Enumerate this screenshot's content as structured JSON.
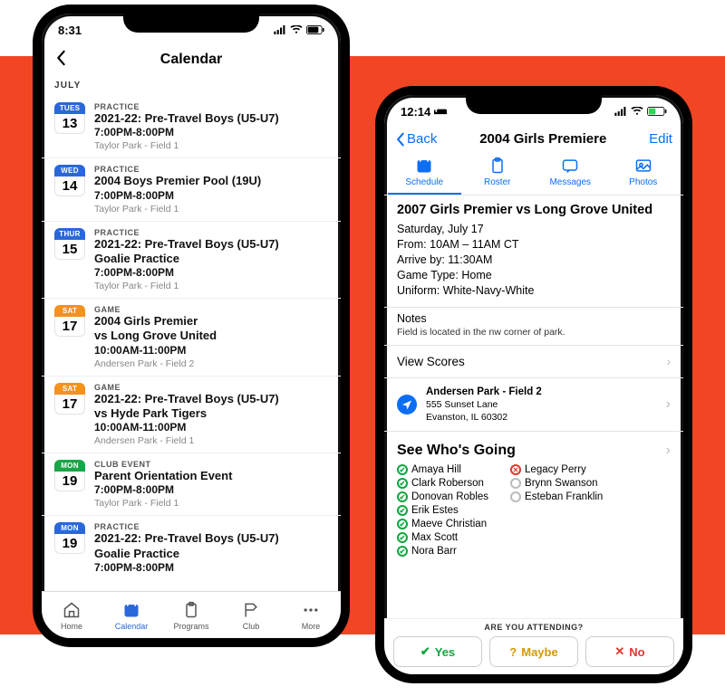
{
  "left": {
    "status_time": "8:31",
    "header_title": "Calendar",
    "month_label": "JULY",
    "events": [
      {
        "dow": "TUES",
        "day": "13",
        "dowColor": "blue",
        "type": "PRACTICE",
        "title": "2021-22: Pre-Travel Boys (U5-U7)",
        "sub": "",
        "time": "7:00PM-8:00PM",
        "loc": "Taylor Park - Field 1"
      },
      {
        "dow": "WED",
        "day": "14",
        "dowColor": "blue",
        "type": "PRACTICE",
        "title": "2004 Boys Premier Pool (19U)",
        "sub": "",
        "time": "7:00PM-8:00PM",
        "loc": "Taylor Park - Field 1"
      },
      {
        "dow": "THUR",
        "day": "15",
        "dowColor": "blue",
        "type": "PRACTICE",
        "title": "2021-22: Pre-Travel Boys (U5-U7)",
        "sub": "Goalie Practice",
        "time": "7:00PM-8:00PM",
        "loc": "Taylor Park - Field 1"
      },
      {
        "dow": "SAT",
        "day": "17",
        "dowColor": "orange",
        "type": "GAME",
        "title": "2004 Girls Premier",
        "sub": "vs Long Grove United",
        "time": "10:00AM-11:00PM",
        "loc": "Andersen Park - Field 2"
      },
      {
        "dow": "SAT",
        "day": "17",
        "dowColor": "orange",
        "type": "GAME",
        "title": "2021-22: Pre-Travel Boys (U5-U7)",
        "sub": "vs Hyde Park Tigers",
        "time": "10:00AM-11:00PM",
        "loc": "Andersen Park - Field 1"
      },
      {
        "dow": "MON",
        "day": "19",
        "dowColor": "green",
        "type": "CLUB EVENT",
        "title": "Parent Orientation Event",
        "sub": "",
        "time": "7:00PM-8:00PM",
        "loc": "Taylor Park - Field 1"
      },
      {
        "dow": "MON",
        "day": "19",
        "dowColor": "blue",
        "type": "PRACTICE",
        "title": "2021-22: Pre-Travel Boys (U5-U7)",
        "sub": "Goalie Practice",
        "time": "7:00PM-8:00PM",
        "loc": ""
      }
    ],
    "tabs": [
      {
        "label": "Home",
        "icon": "home-icon"
      },
      {
        "label": "Calendar",
        "icon": "calendar-icon"
      },
      {
        "label": "Programs",
        "icon": "clipboard-icon"
      },
      {
        "label": "Club",
        "icon": "flag-icon"
      },
      {
        "label": "More",
        "icon": "more-icon"
      }
    ]
  },
  "right": {
    "status_time": "12:14",
    "back_label": "Back",
    "header_title": "2004 Girls Premiere",
    "edit_label": "Edit",
    "seg": [
      {
        "label": "Schedule",
        "icon": "calendar-icon"
      },
      {
        "label": "Roster",
        "icon": "clipboard-icon"
      },
      {
        "label": "Messages",
        "icon": "message-icon"
      },
      {
        "label": "Photos",
        "icon": "photo-icon"
      }
    ],
    "detail": {
      "title": "2007 Girls Premier vs Long Grove United",
      "date": "Saturday, July 17",
      "from_label": "From:",
      "from_value": "10AM – 11AM CT",
      "arrive_label": "Arrive by:",
      "arrive_value": "11:30AM",
      "gametype_label": "Game Type:",
      "gametype_value": "Home",
      "uniform_label": "Uniform:",
      "uniform_value": "White-Navy-White"
    },
    "notes_heading": "Notes",
    "notes_body": "Field is located in the nw corner of park.",
    "view_scores": "View Scores",
    "location": {
      "name": "Andersen Park - Field 2",
      "street": "555 Sunset Lane",
      "city": "Evanston, IL 60302"
    },
    "see_who": "See Who's Going",
    "attendees_yes": [
      "Amaya Hill",
      "Clark Roberson",
      "Donovan Robles",
      "Erik Estes",
      "Maeve Christian",
      "Max Scott",
      "Nora Barr"
    ],
    "attendees_other": [
      {
        "name": "Legacy Perry",
        "status": "no"
      },
      {
        "name": "Brynn Swanson",
        "status": "unk"
      },
      {
        "name": "Esteban Franklin",
        "status": "unk"
      }
    ],
    "attending_q": "ARE YOU ATTENDING?",
    "yes_label": "Yes",
    "maybe_label": "Maybe",
    "no_label": "No"
  }
}
